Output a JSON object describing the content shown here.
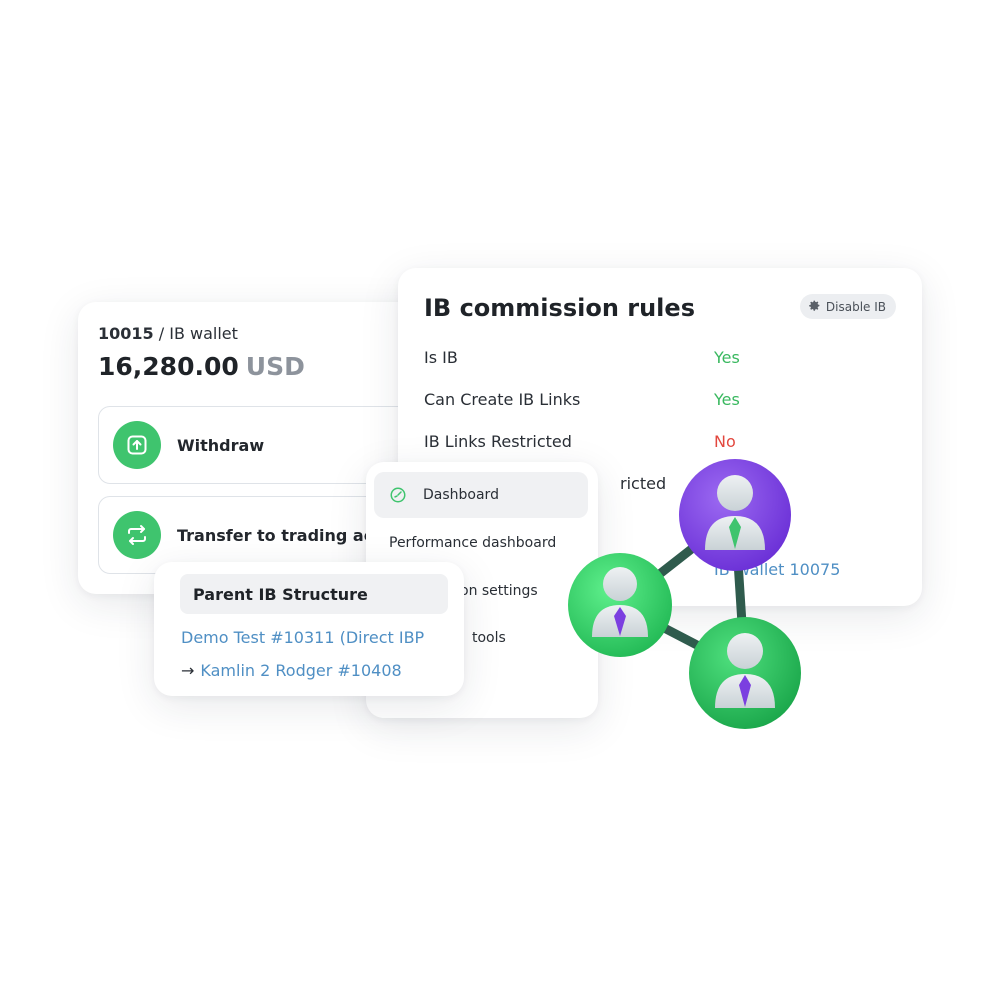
{
  "wallet": {
    "account_number": "10015",
    "separator": " / ",
    "name": "IB wallet",
    "balance": "16,280.00",
    "currency": "USD",
    "actions": [
      {
        "label": "Withdraw",
        "icon": "upload-icon"
      },
      {
        "label": "Transfer to trading acc",
        "icon": "transfer-icon"
      }
    ]
  },
  "rules": {
    "title": "IB commission rules",
    "disable_button": "Disable IB",
    "rows": [
      {
        "label": "Is IB",
        "value": "Yes",
        "status": "positive"
      },
      {
        "label": "Can Create IB Links",
        "value": "Yes",
        "status": "positive"
      },
      {
        "label": "IB Links Restricted",
        "value": "No",
        "status": "negative"
      },
      {
        "label": "ricted",
        "value": "",
        "status": ""
      }
    ],
    "link_text": "IB Wallet 10075"
  },
  "menu": {
    "items": [
      {
        "label": "Dashboard",
        "active": true
      },
      {
        "label": "Performance dashboard",
        "active": false
      },
      {
        "label": "on settings",
        "active": false
      },
      {
        "label": "tools",
        "active": false
      }
    ]
  },
  "parent_ib": {
    "title": "Parent IB Structure",
    "line1": "Demo Test #10311 (Direct IBP",
    "line2_arrow": "→",
    "line2": "Kamlin 2 Rodger #10408"
  },
  "colors": {
    "accent_green": "#3fc46e",
    "positive": "#39b85f",
    "negative": "#e2473e",
    "link": "#4f8fc4",
    "node_purple": "#7c3fe0",
    "node_green": "#33d06a"
  },
  "illustration": {
    "icon": "ib-network-icon"
  }
}
